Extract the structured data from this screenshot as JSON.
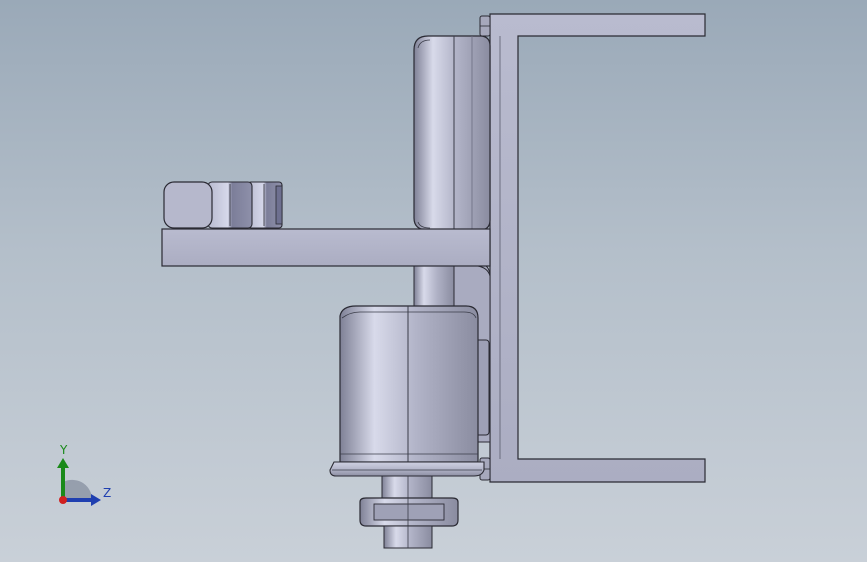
{
  "view": {
    "type": "3D CAD model viewport",
    "background_colors": [
      "#9aa9b8",
      "#c9d0d8"
    ],
    "part_color": "#b6b8cc",
    "edge_color": "#2a2a33"
  },
  "triad": {
    "y_label": "Y",
    "z_label": "Z",
    "x_color": "#d02020",
    "y_color": "#1a8a1a",
    "z_color": "#1f3fb0"
  }
}
